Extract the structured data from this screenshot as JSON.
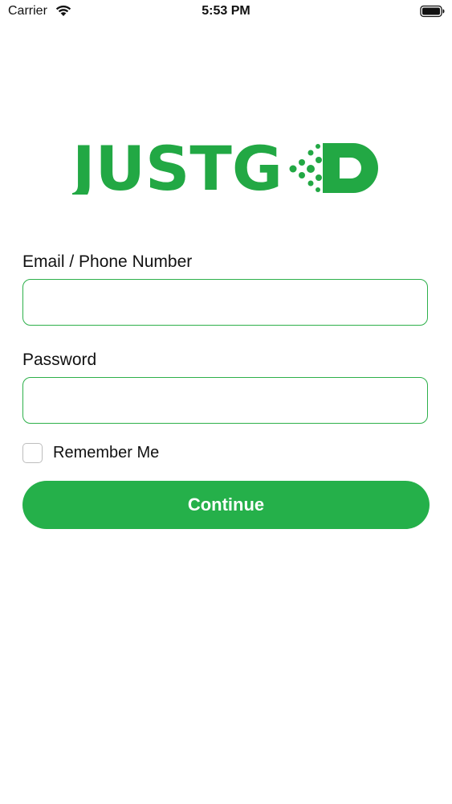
{
  "status_bar": {
    "carrier": "Carrier",
    "time": "5:53 PM"
  },
  "logo": {
    "text": "JUSTGO",
    "color": "#22a844"
  },
  "form": {
    "email_label": "Email / Phone Number",
    "email_value": "",
    "email_placeholder": "",
    "password_label": "Password",
    "password_value": "",
    "password_placeholder": "",
    "remember_label": "Remember Me",
    "remember_checked": false,
    "continue_label": "Continue"
  },
  "colors": {
    "accent": "#25b04a",
    "border": "#2db04a"
  }
}
